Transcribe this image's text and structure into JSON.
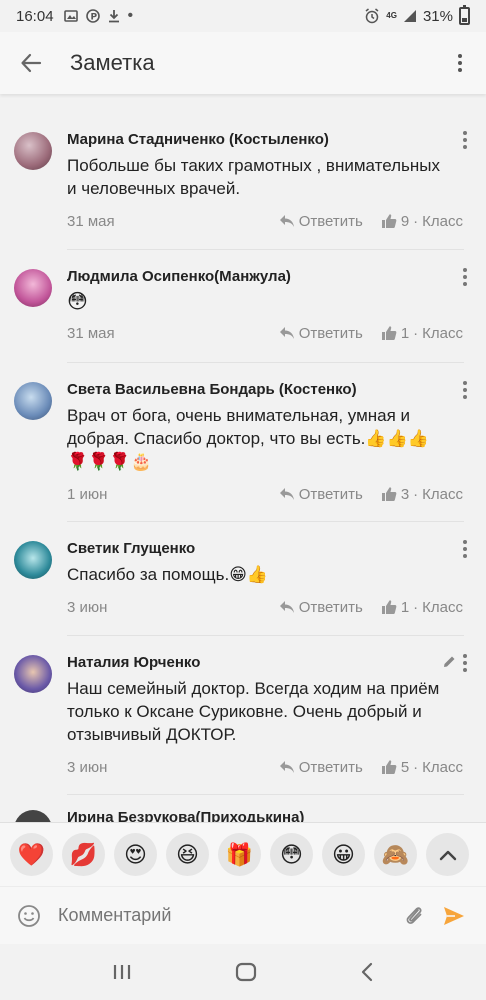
{
  "status": {
    "time": "16:04",
    "network": "4G",
    "battery": "31%"
  },
  "appbar": {
    "title": "Заметка"
  },
  "actions": {
    "reply": "Ответить",
    "klass": "Класс"
  },
  "comments": [
    {
      "author": "Марина Стадниченко (Костыленко)",
      "text": "Побольше бы таких грамотных , внимательных и человечных врачей.",
      "date": "31 мая",
      "likes": "9",
      "avatar_color": "#9c6b7a"
    },
    {
      "author": "Людмила Осипенко(Манжула)",
      "text": "😳",
      "date": "31 мая",
      "likes": "1",
      "avatar_color": "#c2569a"
    },
    {
      "author": "Света Васильевна Бондарь (Костенко)",
      "text": "Врач от бога, очень внимательная, умная и добрая. Спасибо доктор, что вы есть.👍👍👍🌹🌹🌹🎂",
      "date": "1 июн",
      "likes": "3",
      "avatar_color": "#6a8bb8"
    },
    {
      "author": "Светик Глущенко",
      "text": "Спасибо за помощь.😁👍",
      "date": "3 июн",
      "likes": "1",
      "avatar_color": "#2e8a9a"
    },
    {
      "author": "Наталия Юрченко",
      "text": "Наш семейный доктор. Всегда ходим на приём только к Оксане Суриковне. Очень добрый и отзывчивый ДОКТОР.",
      "date": "3 июн",
      "likes": "5",
      "avatar_color": "#6b5aa8"
    },
    {
      "author": "Ирина Безрукова(Приходькина)",
      "avatar_color": "#444444"
    }
  ],
  "emoji_bar": [
    "❤️",
    "💋",
    "😍",
    "😆",
    "🎁",
    "😳",
    "😀",
    "🙈"
  ],
  "input": {
    "placeholder": "Комментарий"
  }
}
